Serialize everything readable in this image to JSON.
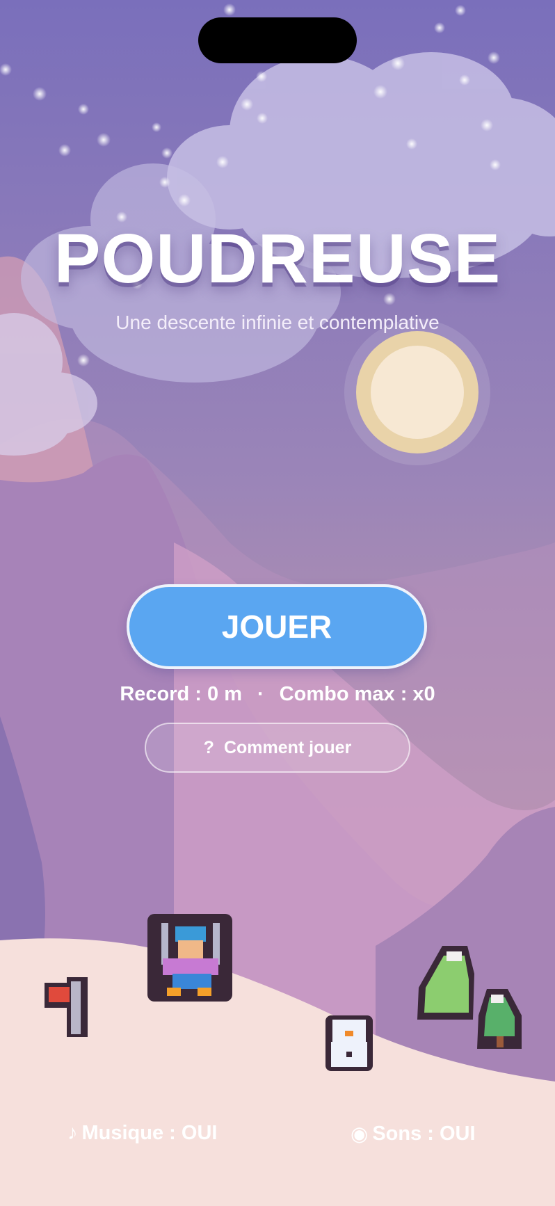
{
  "game": {
    "title": "POUDREUSE",
    "subtitle": "Une descente infinie et contemplative"
  },
  "menu": {
    "play_label": "JOUER",
    "record_label": "Record : 0 m",
    "separator": "·",
    "combo_label": "Combo max : x0",
    "help_icon": "?",
    "help_label": "Comment jouer"
  },
  "settings": {
    "music_icon": "♪",
    "music_label": "Musique : OUI",
    "sound_icon": "◉",
    "sound_label": "Sons : OUI"
  },
  "colors": {
    "sky_top": "#7a6fbb",
    "sky_bottom": "#c79ca8",
    "snow": "#f6e0dc",
    "button_blue": "#5aa6f1",
    "moon": "#f7e8d3"
  },
  "sprites": [
    "skier",
    "flag",
    "snowman",
    "pine-tree",
    "pine-tree"
  ]
}
